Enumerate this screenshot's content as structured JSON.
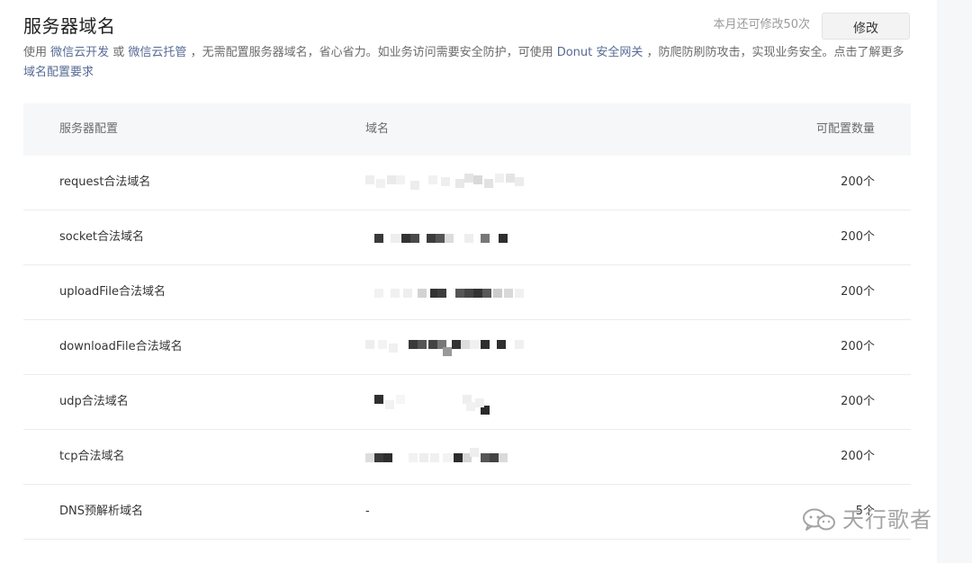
{
  "header": {
    "title": "服务器域名",
    "quota_text": "本月还可修改50次",
    "modify_label": "修改"
  },
  "description": {
    "text_1": "使用 ",
    "link_1": "微信云开发",
    "text_2": " 或 ",
    "link_2": "微信云托管",
    "text_3": " ，无需配置服务器域名，省心省力。如业务访问需要安全防护，可使用 ",
    "link_3": "Donut 安全网关",
    "text_4": " ，防爬防刷防攻击，实现业务安全。点击了解更多 ",
    "link_4": "域名配置要求"
  },
  "table": {
    "headers": {
      "config": "服务器配置",
      "domain": "域名",
      "count": "可配置数量"
    },
    "rows": [
      {
        "config": "request合法域名",
        "domain": "",
        "count": "200个"
      },
      {
        "config": "socket合法域名",
        "domain": "",
        "count": "200个"
      },
      {
        "config": "uploadFile合法域名",
        "domain": "",
        "count": "200个"
      },
      {
        "config": "downloadFile合法域名",
        "domain": "",
        "count": "200个"
      },
      {
        "config": "udp合法域名",
        "domain": "",
        "count": "200个"
      },
      {
        "config": "tcp合法域名",
        "domain": "",
        "count": "200个"
      },
      {
        "config": "DNS预解析域名",
        "domain": "-",
        "count": "5个"
      }
    ]
  },
  "watermark": {
    "text": "天行歌者",
    "icon": "wechat-icon"
  }
}
